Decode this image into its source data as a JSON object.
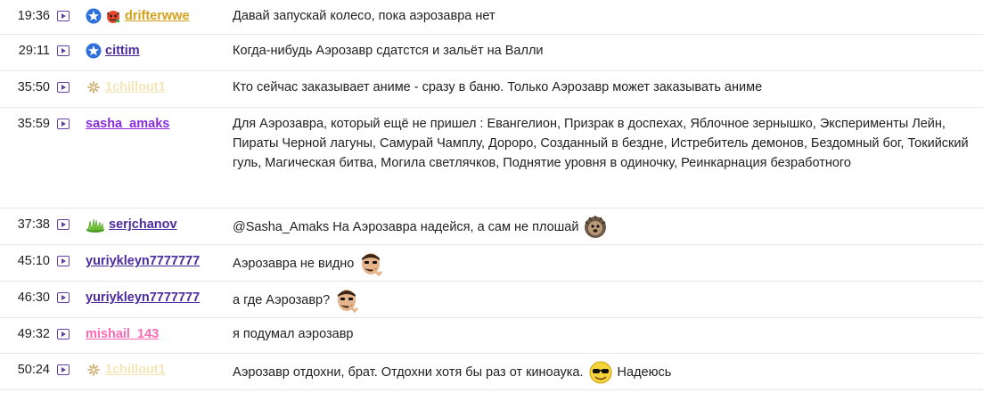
{
  "rows": [
    {
      "time": "19:36",
      "user": "drifterwwe",
      "color": "#d4a017",
      "badges": [
        "prime-star-icon",
        "devil-emote-icon"
      ],
      "message": "Давай запускай колесо, пока аэрозавра нет"
    },
    {
      "time": "29:11",
      "user": "cittim",
      "color": "#4b2c9e",
      "badges": [
        "prime-star-icon"
      ],
      "message": "Когда-нибудь Аэрозавр сдатстся и зальёт на Валли"
    },
    {
      "time": "35:50",
      "user": "1chillout1",
      "color": "#f5e6b8",
      "badges": [
        "sparkle-icon"
      ],
      "message": "Кто сейчас заказывает аниме - сразу в баню. Только Аэрозавр может заказывать аниме"
    },
    {
      "time": "35:59",
      "user": "sasha_amaks",
      "color": "#8a2be2",
      "badges": [],
      "message": "Для Аэрозавра, который ещё не пришел : Евангелион, Призрак в доспехах, Яблочное зернышко, Эксперименты Лейн, Пираты Черной лагуны, Самурай Чамплу, Дороро, Созданный в бездне, Истребитель демонов, Бездомный бог, Токийский гуль, Магическая битва, Могила светлячков, Поднятие уровня в одиночку, Реинкарнация безработного"
    },
    {
      "time": "37:38",
      "user": "serjchanov",
      "color": "#4b2c9e",
      "badges": [
        "grass-icon"
      ],
      "message": "@Sasha_Amaks На Аэрозавра надейся, а сам не плошай",
      "emote": "hedgehog-emote-icon"
    },
    {
      "time": "45:10",
      "user": "yuriykleyn7777777",
      "color": "#4b2c9e",
      "badges": [],
      "message": "Аэрозавра не видно",
      "emote": "thinking-man-emote-icon"
    },
    {
      "time": "46:30",
      "user": "yuriykleyn7777777",
      "color": "#4b2c9e",
      "badges": [],
      "message": "а где Аэрозавр?",
      "emote": "thinking-man-emote-icon"
    },
    {
      "time": "49:32",
      "user": "mishail_143",
      "color": "#ff69b4",
      "badges": [],
      "message": "я подумал аэрозавр"
    },
    {
      "time": "50:24",
      "user": "1chillout1",
      "color": "#f5e6b8",
      "badges": [
        "sparkle-icon"
      ],
      "message": "Аэрозавр отдохни, брат. Отдохни хотя бы раз от киноаука.",
      "emote": "cool-face-emote-icon",
      "message_after": "Надеюсь"
    }
  ]
}
